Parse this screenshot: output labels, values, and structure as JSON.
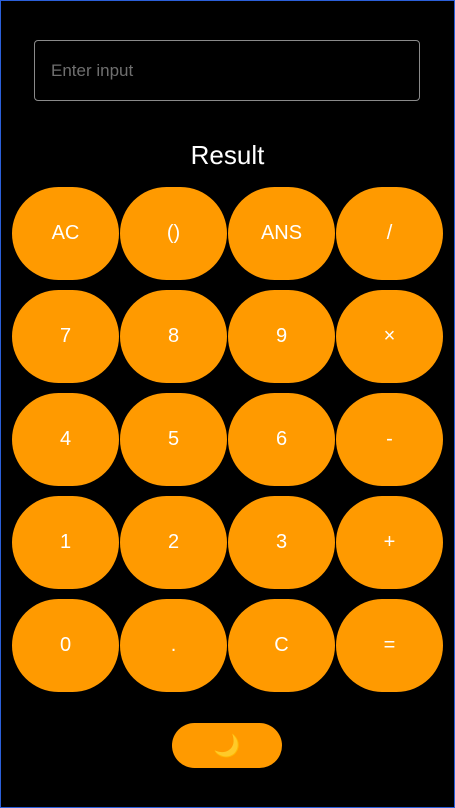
{
  "input": {
    "placeholder": "Enter input",
    "value": ""
  },
  "result": {
    "label": "Result"
  },
  "keys": [
    "AC",
    "()",
    "ANS",
    "/",
    "7",
    "8",
    "9",
    "×",
    "4",
    "5",
    "6",
    "-",
    "1",
    "2",
    "3",
    "+",
    "0",
    ".",
    "C",
    "="
  ],
  "theme_toggle": {
    "icon": "moon-icon",
    "glyph": "🌙"
  },
  "colors": {
    "background": "#000000",
    "accent": "#ff9a00",
    "text": "#ffffff",
    "input_border": "#8a8a8a"
  }
}
